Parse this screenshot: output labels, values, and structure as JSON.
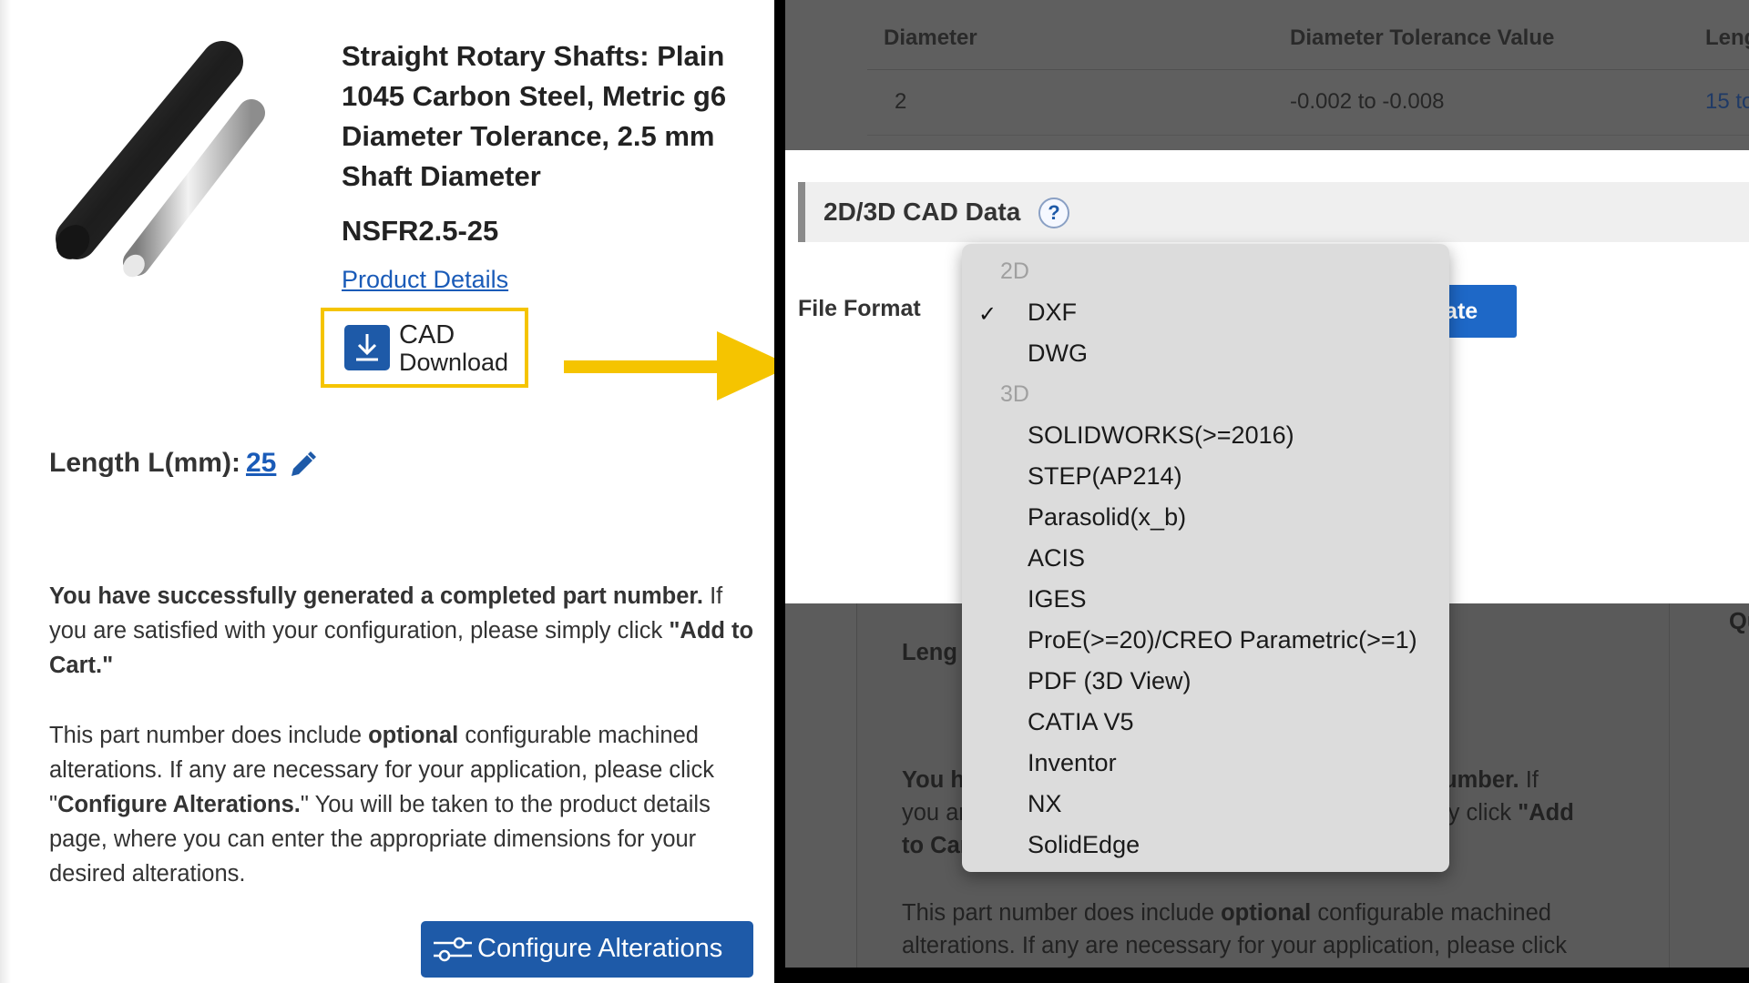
{
  "product": {
    "title": "Straight Rotary Shafts: Plain 1045 Carbon Steel, Metric g6 Diameter Tolerance, 2.5 mm Shaft Diameter",
    "part_number": "NSFR2.5-25",
    "details_link": "Product Details",
    "cad_label_1": "CAD",
    "cad_label_2": "Download",
    "length_label": "Length L(mm):",
    "length_value": "25",
    "para1_bold": "You have successfully generated a completed part number.",
    "para1_a": " If you are satisfied with your configuration, please simply click ",
    "para1_bold2": "\"Add to Cart.\"",
    "para2_a": "This part number does include ",
    "para2_bold": "optional",
    "para2_b": " configurable machined alterations. If any are necessary for your application, please click \"",
    "para2_bold2": "Configure Alterations.",
    "para2_c": "\" You will be taken to the product details page, where you can enter the appropriate dimensions for your desired alterations.",
    "configure_button": "Configure Alterations"
  },
  "background_table": {
    "col_diameter": "Diameter",
    "col_tolerance": "Diameter Tolerance Value",
    "col_length": "Leng",
    "row_diameter": "2",
    "row_tolerance": "-0.002 to -0.008",
    "row_length": "15 to"
  },
  "modal": {
    "header": "2D/3D CAD Data",
    "help": "?",
    "file_format_label": "File Format",
    "generate_button": "Generate"
  },
  "dropdown": {
    "group_2d": "2D",
    "items_2d": [
      "DXF",
      "DWG"
    ],
    "group_3d": "3D",
    "items_3d": [
      "SOLIDWORKS(>=2016)",
      "STEP(AP214)",
      "Parasolid(x_b)",
      "ACIS",
      "IGES",
      "ProE(>=20)/CREO Parametric(>=1)",
      "PDF (3D View)",
      "CATIA V5",
      "Inventor",
      "NX",
      "SolidEdge"
    ],
    "selected": "DXF",
    "check": "✓"
  },
  "dimmed_page": {
    "length_partial": "Leng",
    "qty_partial": "Qu",
    "you_partial": "You ha",
    "umber_partial": "umber.",
    "umber_tail": " If",
    "youar_partial": "you ar",
    "lyclick_partial": "ly click ",
    "add_partial": "\"Add",
    "tocar_partial": "to Car",
    "partnum_a": "This part number does include ",
    "partnum_bold": "optional",
    "partnum_b": " configurable machined",
    "alter_line": "alterations. If any are necessary for your application, please click"
  },
  "colors": {
    "brand_blue": "#1e5aa8",
    "highlight_yellow": "#f5c400",
    "link_blue": "#1a5bb8"
  }
}
